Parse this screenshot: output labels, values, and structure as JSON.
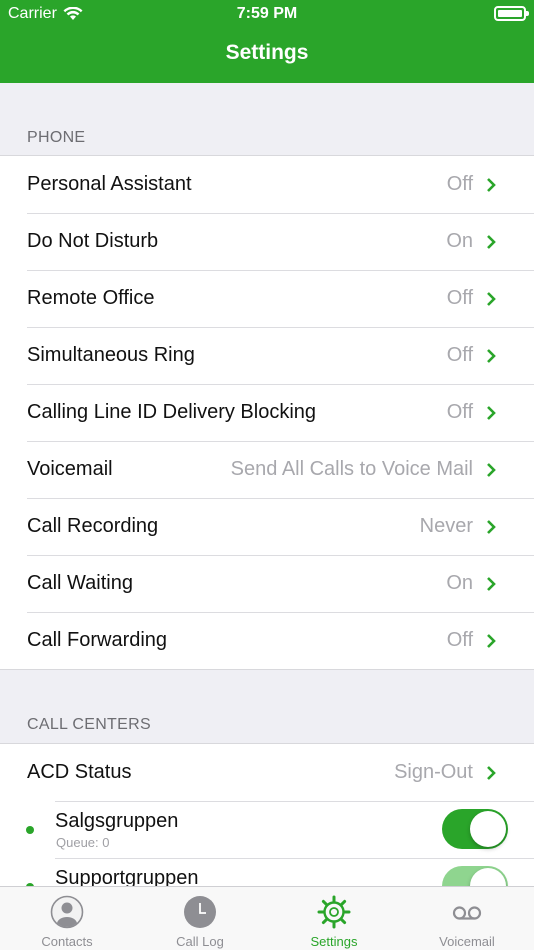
{
  "status_bar": {
    "carrier": "Carrier",
    "time": "7:59 PM"
  },
  "nav": {
    "title": "Settings"
  },
  "sections": {
    "phone": {
      "header": "PHONE",
      "rows": [
        {
          "label": "Personal Assistant",
          "value": "Off"
        },
        {
          "label": "Do Not Disturb",
          "value": "On"
        },
        {
          "label": "Remote Office",
          "value": "Off"
        },
        {
          "label": "Simultaneous Ring",
          "value": "Off"
        },
        {
          "label": "Calling Line ID Delivery Blocking",
          "value": "Off"
        },
        {
          "label": "Voicemail",
          "value": "Send All Calls to Voice Mail"
        },
        {
          "label": "Call Recording",
          "value": "Never"
        },
        {
          "label": "Call Waiting",
          "value": "On"
        },
        {
          "label": "Call Forwarding",
          "value": "Off"
        }
      ]
    },
    "call_centers": {
      "header": "CALL CENTERS",
      "acd": {
        "label": "ACD Status",
        "value": "Sign-Out"
      },
      "queues": [
        {
          "name": "Salgsgruppen",
          "detail": "Queue: 0",
          "enabled": true
        },
        {
          "name": "Supportgruppen",
          "detail": "",
          "enabled": true
        }
      ]
    }
  },
  "tabbar": {
    "tabs": [
      {
        "label": "Contacts",
        "icon": "contacts-icon",
        "active": false
      },
      {
        "label": "Call Log",
        "icon": "call-log-clock-icon",
        "active": false
      },
      {
        "label": "Settings",
        "icon": "settings-gear-icon",
        "active": true
      },
      {
        "label": "Voicemail",
        "icon": "voicemail-icon",
        "active": false
      }
    ]
  },
  "colors": {
    "accent": "#2aa52a",
    "value_text": "#a8a8ad",
    "background": "#efeff4"
  }
}
